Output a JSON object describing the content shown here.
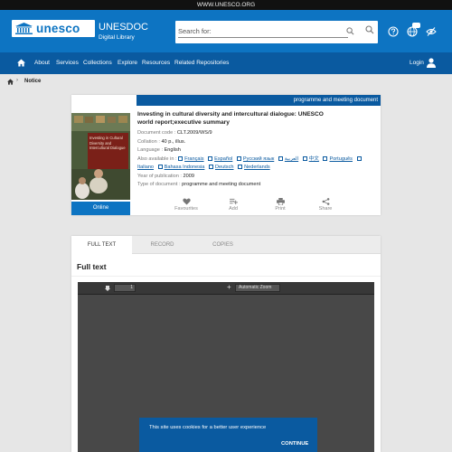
{
  "top_strip": {
    "url": "WWW.UNESCO.ORG"
  },
  "header": {
    "logo_word": "unesco",
    "brand_title": "UNESDOC",
    "brand_subtitle": "Digital Library",
    "search": {
      "placeholder": "Search for:",
      "value": ""
    },
    "icons": [
      "help-icon",
      "language-globe-icon",
      "accessibility-icon"
    ],
    "badge": "EN"
  },
  "nav": {
    "items": [
      "About",
      "Services",
      "Collections",
      "Explore",
      "Resources",
      "Related Repositories"
    ],
    "login": "Login"
  },
  "breadcrumb": {
    "current": "Notice"
  },
  "notice": {
    "doc_type": "programme and meeting document",
    "title": "Investing in cultural diversity and intercultural dialogue: UNESCO world report;executive summary",
    "meta": [
      {
        "key": "Document code :",
        "value": "CLT.2009/WS/9"
      },
      {
        "key": "Collation :",
        "value": "40 p., illus."
      },
      {
        "key": "Language :",
        "value": "English"
      }
    ],
    "also_available_label": "Also available in :",
    "languages_line1": [
      "Français",
      "Español",
      "Русский язык",
      "العربية",
      "中文",
      "Português"
    ],
    "languages_line2": [
      "Italiano",
      "Bahasa Indonesia",
      "Deutsch",
      "Nederlands"
    ],
    "year_key": "Year of publication :",
    "year_value": "2009",
    "type_key": "Type of document :",
    "type_value": "programme and meeting document",
    "online": "Online",
    "actions": [
      "Favourites",
      "Add",
      "Print",
      "Share"
    ],
    "cover_text": "Investing in Cultural Diversity and Intercultural Dialogue"
  },
  "fulltext": {
    "tabs": [
      "FULL TEXT",
      "RECORD",
      "COPIES"
    ],
    "heading": "Full text",
    "viewer": {
      "page": "1",
      "zoom": "Automatic Zoom"
    }
  },
  "cookie": {
    "text": "This site uses cookies for a better user experience",
    "button": "CONTINUE"
  },
  "colors": {
    "primary": "#0d74c2",
    "nav": "#0a5aa0",
    "viewer": "#484848"
  }
}
